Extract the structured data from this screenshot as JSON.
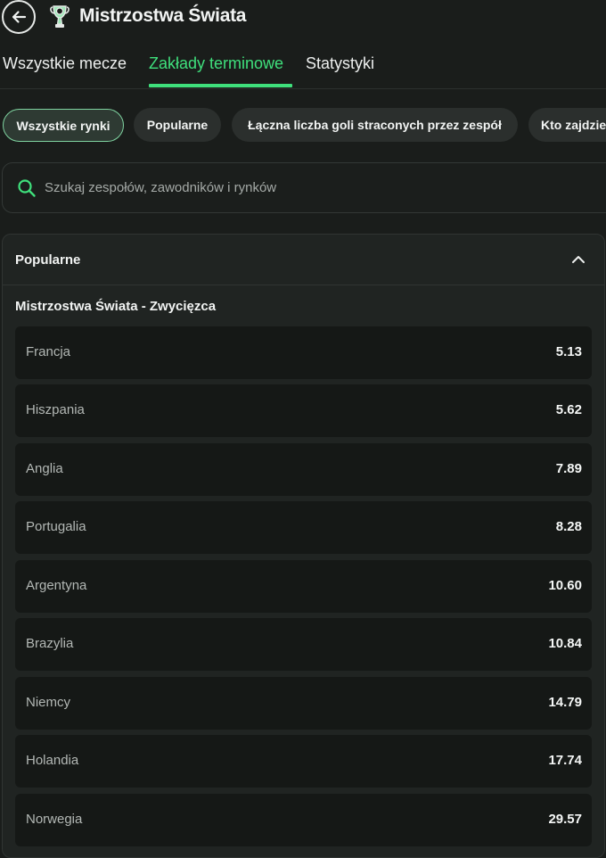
{
  "header": {
    "title": "Mistrzostwa Świata",
    "back_icon": "arrow-left-icon",
    "trophy_icon": "trophy-icon"
  },
  "tabs": [
    {
      "label": "Wszystkie mecze",
      "active": false
    },
    {
      "label": "Zakłady terminowe",
      "active": true
    },
    {
      "label": "Statystyki",
      "active": false
    }
  ],
  "chips": [
    {
      "label": "Wszystkie rynki",
      "active": true
    },
    {
      "label": "Popularne",
      "active": false
    },
    {
      "label": "Łączna liczba goli straconych przez zespół",
      "active": false
    },
    {
      "label": "Kto zajdzie",
      "active": false
    }
  ],
  "search": {
    "placeholder": "Szukaj zespołów, zawodników i rynków"
  },
  "section": {
    "title": "Popularne",
    "market_title": "Mistrzostwa Świata - Zwycięzca",
    "rows": [
      {
        "name": "Francja",
        "odds": "5.13"
      },
      {
        "name": "Hiszpania",
        "odds": "5.62"
      },
      {
        "name": "Anglia",
        "odds": "7.89"
      },
      {
        "name": "Portugalia",
        "odds": "8.28"
      },
      {
        "name": "Argentyna",
        "odds": "10.60"
      },
      {
        "name": "Brazylia",
        "odds": "10.84"
      },
      {
        "name": "Niemcy",
        "odds": "14.79"
      },
      {
        "name": "Holandia",
        "odds": "17.74"
      },
      {
        "name": "Norwegia",
        "odds": "29.57"
      }
    ]
  },
  "colors": {
    "accent": "#3fe07c",
    "background": "#1a1d1b"
  }
}
